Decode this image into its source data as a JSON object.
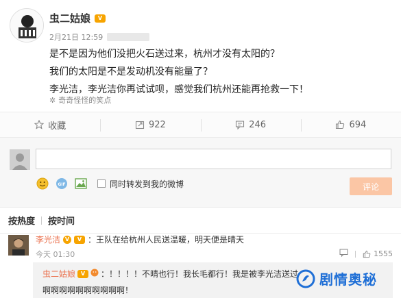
{
  "post": {
    "author": "虫二姑娘",
    "date": "2月21日 12:59",
    "lines": [
      "是不是因为他们没把火石送过来，杭州才没有太阳的？",
      "我们的太阳是不是发动机没有能量了？",
      "李光洁，李光洁你再试试呗，感觉我们杭州还能再抢救一下！"
    ],
    "topic": "奇奇怪怪的笑点"
  },
  "actions": {
    "favorite": "收藏",
    "repost": "922",
    "comment": "246",
    "like": "694"
  },
  "comment_box": {
    "placeholder": "",
    "repost_label": "同时转发到我的微博",
    "submit": "评论"
  },
  "sort": {
    "hot": "按热度",
    "time": "按时间"
  },
  "comments": [
    {
      "user": "李光洁",
      "text": "：王队在给杭州人民送温暖，明天便是晴天",
      "time": "今天 01:30",
      "likes": "1555"
    }
  ],
  "reply": {
    "user": "虫二姑娘",
    "text": "：！！！！不晴也行！我长毛都行！我是被李光洁送过",
    "text2": "啊啊啊啊啊啊啊啊啊啊！"
  },
  "watermark": "剧情奥秘",
  "colors": {
    "accent": "#eb7350",
    "watermark": "#1f6fd6",
    "submit": "#fbc6a5"
  }
}
